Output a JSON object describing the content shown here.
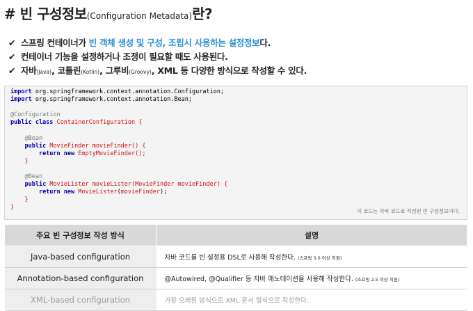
{
  "title": {
    "main": "# 빈 구성정보",
    "sub": "(Configuration Metadata)",
    "suffix": "란?"
  },
  "bullets": [
    {
      "segments": [
        "스프링 컨테이너가 ",
        "빈 객체 생성 및 구성, 조립시 사용하는 설정정보",
        "다."
      ]
    },
    {
      "text": "컨테이너 기능을 설정하거나 조정이 필요할 때도 사용된다."
    },
    {
      "segments": [
        "자바",
        "(Java)",
        ", 코틀린",
        "(Kotlin)",
        ", 그루비",
        "(Groovy)",
        ", XML 등 다양한 방식으로 작성할 수 있다."
      ]
    }
  ],
  "checkmark": "✔",
  "code": {
    "line1": [
      "import",
      " org.springframework.context.annotation.Configuration;"
    ],
    "line2": [
      "import",
      " org.springframework.context.annotation.Bean;"
    ],
    "line4": "@Configuration",
    "line5": [
      "public class",
      " ContainerConfiguration",
      " {"
    ],
    "line7": "@Bean",
    "line8": [
      "public",
      " MovieFinder",
      " movieFinder()",
      " {"
    ],
    "line9": [
      "return new",
      " EmptyMovieFinder();"
    ],
    "line10": "}",
    "line12": "@Bean",
    "line13": [
      "public",
      " MovieLister",
      " movieLister(MovieFinder movieFinder)",
      " {"
    ],
    "line14": [
      "return new",
      " MovieLister",
      "(",
      "movieFinder",
      ");"
    ],
    "line15": "}",
    "line16": "}",
    "caption": "이 코드는 자바 코드로 작성된 빈 구성정보이다."
  },
  "table": {
    "headers": [
      "주요 빈 구성정보 작성 방식",
      "설명"
    ],
    "rows": [
      {
        "method": "Java-based configuration",
        "desc": "자바 코드를 빈 설정용 DSL로 사용해 작성한다.",
        "note": "(스프링 3.0 이상 지원)"
      },
      {
        "method": "Annotation-based configuration",
        "desc": "@Autowired, @Qualifier 등 자바 애노테이션을 사용해 작성한다.",
        "note": "(스프링 2.5 이상 지원)"
      },
      {
        "method": "XML-based configuration",
        "desc": "가장 오래된 방식으로 XML 문서 형식으로 작성한다.",
        "note": ""
      }
    ]
  }
}
